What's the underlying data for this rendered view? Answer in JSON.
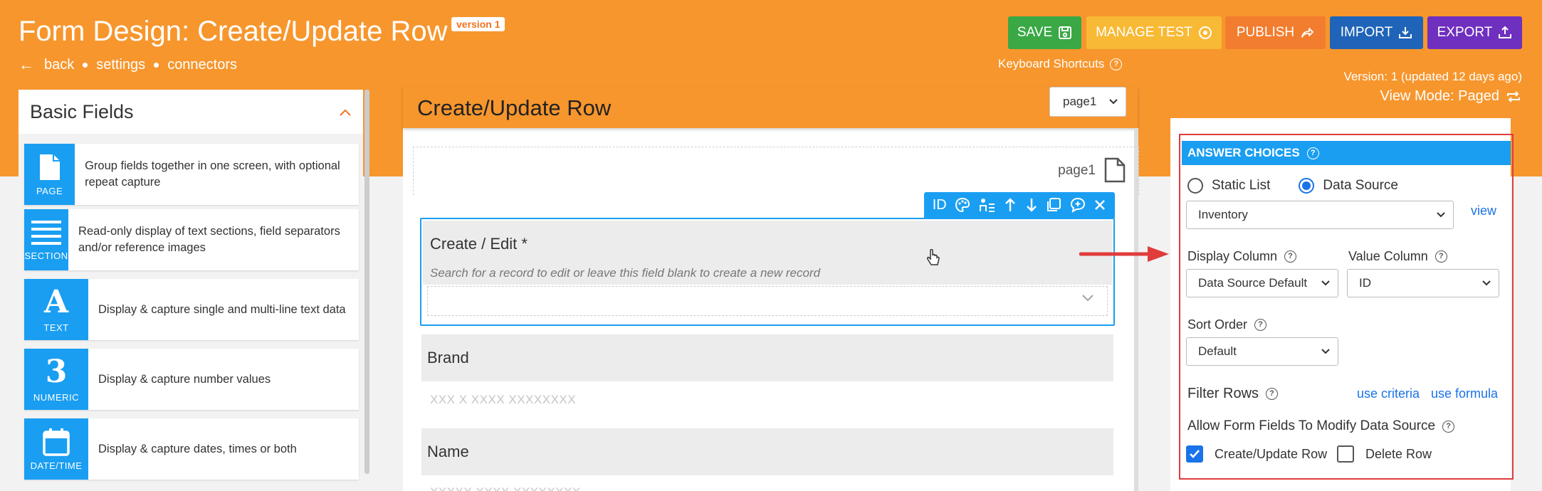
{
  "header": {
    "title": "Form Design: Create/Update Row",
    "version_badge": "version 1",
    "nav": {
      "back": "back",
      "settings": "settings",
      "connectors": "connectors"
    },
    "buttons": {
      "save": "SAVE",
      "manage_test": "MANAGE TEST",
      "publish": "PUBLISH",
      "import": "IMPORT",
      "export": "EXPORT"
    },
    "keyboard_shortcuts": "Keyboard Shortcuts",
    "version_info": "Version: 1 (updated 12 days ago)",
    "view_mode": "View Mode: Paged"
  },
  "basic_fields": {
    "title": "Basic Fields",
    "items": [
      {
        "label": "PAGE",
        "desc": "Group fields together in one screen, with optional repeat capture"
      },
      {
        "label": "SECTION",
        "desc": "Read-only display of text sections, field separators and/or reference images"
      },
      {
        "label": "TEXT",
        "glyph": "A",
        "desc": "Display & capture single and multi-line text data"
      },
      {
        "label": "NUMERIC",
        "glyph": "3",
        "desc": "Display & capture number values"
      },
      {
        "label": "DATE/TIME",
        "desc": "Display & capture dates, times or both"
      }
    ]
  },
  "form": {
    "title": "Create/Update Row",
    "page_select": "page1",
    "page_label": "page1",
    "toolbar_id": "ID",
    "questions": [
      {
        "title": "Create / Edit *",
        "hint": "Search for a record to edit or leave this field blank to create a new record"
      },
      {
        "title": "Brand",
        "sub": "XXX X XXXX XXXXXXXX"
      },
      {
        "title": "Name",
        "sub": "XXXXX XXXX XXXXXXXX"
      }
    ]
  },
  "answer_choices": {
    "title": "ANSWER CHOICES",
    "radio_static": "Static List",
    "radio_source": "Data Source",
    "data_source": "Inventory",
    "view_link": "view",
    "display_column_label": "Display Column",
    "display_column_value": "Data Source Default",
    "value_column_label": "Value Column",
    "value_column_value": "ID",
    "sort_order_label": "Sort Order",
    "sort_order_value": "Default",
    "filter_rows_label": "Filter Rows",
    "use_criteria": "use criteria",
    "use_formula": "use formula",
    "allow_modify_label": "Allow Form Fields To Modify Data Source",
    "create_update_row": "Create/Update Row",
    "delete_row": "Delete Row"
  }
}
